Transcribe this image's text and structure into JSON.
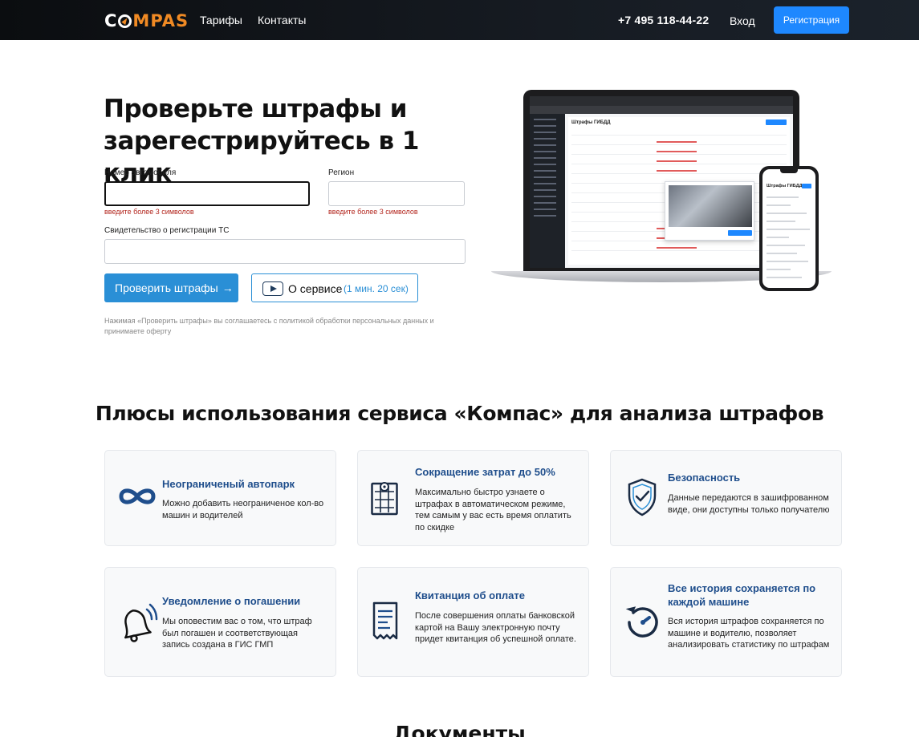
{
  "header": {
    "logo": {
      "part1": "C",
      "part2": "MP",
      "part3": "AS"
    },
    "nav": [
      "Тарифы",
      "Контакты"
    ],
    "phone": "+7 495 118-44-22",
    "login": "Вход",
    "register": "Регистрация"
  },
  "hero": {
    "title_line1": "Проверьте штрафы и",
    "title_line2": "зарегестрируйтесь в 1 клик",
    "plate_label": "Номер автомобиля",
    "plate_value": "",
    "plate_error": "введите более 3 символов",
    "region_label": "Регион",
    "region_value": "",
    "region_error": "введите более 3 символов",
    "sts_label": "Свидетельство о регистрации ТС",
    "sts_value": "",
    "check_button": "Проверить штрафы",
    "check_arrow": "→",
    "about_button": "О сервисе",
    "about_duration": "(1 мин. 20 сек)",
    "consent": "Нажимая «Проверить штрафы» вы соглашаетесь с политикой обработки персональных данных и принимаете оферту"
  },
  "mockup": {
    "screen_title": "Штрафы ГИБДД",
    "phone_title": "Штрафы ГИБДД"
  },
  "benefits": {
    "title": "Плюсы использования сервиса «Компас» для анализа штрафов",
    "cards": [
      {
        "title": "Неограниченый автопарк",
        "text": "Можно добавить неограниченое кол-во машин и водителей",
        "icon": "infinity-icon"
      },
      {
        "title": "Сокращение затрат до 50%",
        "text": "Максимально быстро узнаете о штрафах в автоматическом режиме, тем самым у вас есть время оплатить по скидке",
        "icon": "map-pin-icon"
      },
      {
        "title": "Безопасность",
        "text": "Данные передаются в зашифрованном виде, они доступны только получателю",
        "icon": "shield-check-icon"
      },
      {
        "title": "Уведомление о погашении",
        "text": "Мы оповестим вас о том, что штраф был погашен и соответствующая запись создана в ГИС ГМП",
        "icon": "bell-icon"
      },
      {
        "title": "Квитанция об оплате",
        "text": "После совершения оплаты банковской картой на Вашу электронную почту придет квитанция об успешной оплате.",
        "icon": "receipt-icon"
      },
      {
        "title": "Все история сохраняется по каждой машине",
        "text": "Вся история штрафов сохраняется по машине и водителю, позволяет анализировать статистику по штрафам",
        "icon": "history-icon"
      }
    ]
  },
  "documents": {
    "title": "Документы"
  },
  "colors": {
    "accent": "#2a8fd6",
    "brand_orange": "#f08a24",
    "primary_button": "#1e88ff",
    "card_title": "#1f4e8c",
    "error": "#b3261e"
  }
}
